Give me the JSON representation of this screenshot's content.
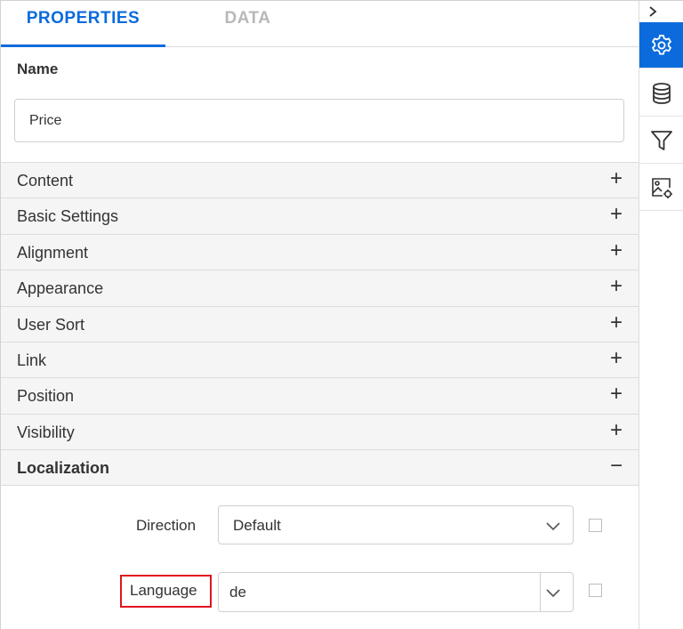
{
  "tabs": [
    {
      "label": "PROPERTIES",
      "active": true
    },
    {
      "label": "DATA",
      "active": false
    }
  ],
  "name_section": {
    "label": "Name",
    "value": "Price"
  },
  "accordion": [
    {
      "label": "Content",
      "expanded": false,
      "sign": "+"
    },
    {
      "label": "Basic Settings",
      "expanded": false,
      "sign": "+"
    },
    {
      "label": "Alignment",
      "expanded": false,
      "sign": "+"
    },
    {
      "label": "Appearance",
      "expanded": false,
      "sign": "+"
    },
    {
      "label": "User Sort",
      "expanded": false,
      "sign": "+"
    },
    {
      "label": "Link",
      "expanded": false,
      "sign": "+"
    },
    {
      "label": "Position",
      "expanded": false,
      "sign": "+"
    },
    {
      "label": "Visibility",
      "expanded": false,
      "sign": "+"
    },
    {
      "label": "Localization",
      "expanded": true,
      "sign": "−"
    }
  ],
  "localization": {
    "direction": {
      "label": "Direction",
      "value": "Default"
    },
    "language": {
      "label": "Language",
      "value": "de"
    }
  },
  "sidebar": {
    "icons": [
      "chevron-right-icon",
      "gear-icon",
      "database-icon",
      "filter-icon",
      "image-settings-icon"
    ]
  },
  "colors": {
    "accent": "#0b6bdc",
    "highlight": "#e0141e",
    "row_bg": "#f5f5f5"
  }
}
